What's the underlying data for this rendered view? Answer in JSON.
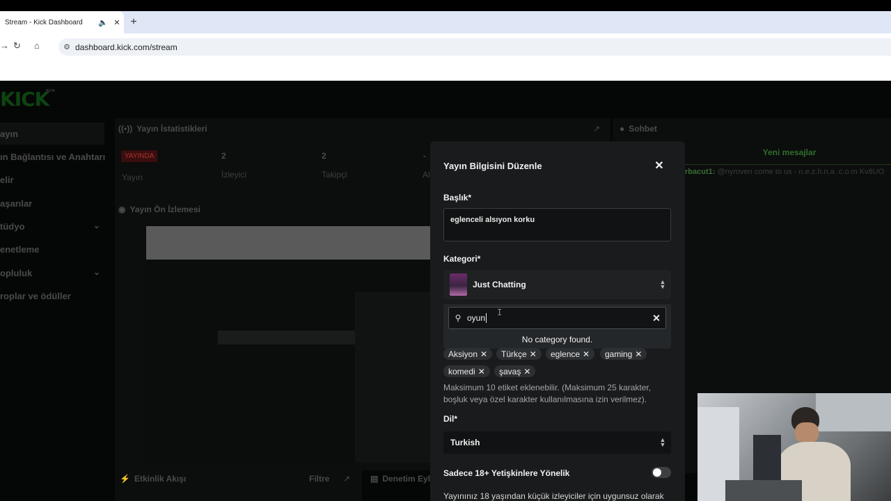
{
  "browser": {
    "tab_title": "Stream - Kick Dashboard",
    "url": "dashboard.kick.com/stream"
  },
  "sidebar": {
    "logo": "KICK",
    "logo_badge": "BETA",
    "items": [
      {
        "label": "ayın"
      },
      {
        "label": "ın Bağlantısı ve Anahtarı"
      },
      {
        "label": "elir"
      },
      {
        "label": "aşarılar"
      },
      {
        "label": "tüdyo"
      },
      {
        "label": "enetleme"
      },
      {
        "label": "opluluk"
      },
      {
        "label": "roplar ve ödüller"
      }
    ]
  },
  "stats": {
    "title": "Yayın İstatistikleri",
    "live_badge": "YAYINDA",
    "live_label": "Yayın",
    "viewers_value": "2",
    "viewers_label": "İzleyici",
    "followers_value": "2",
    "followers_label": "Takipçi",
    "extra_value": "-",
    "extra_label": "Al"
  },
  "preview": {
    "title": "Yayın Ön İzlemesi"
  },
  "chat": {
    "title": "Sohbet",
    "new_messages": "Yeni mesajlar",
    "message_user": "rbacut1:",
    "message_text": "@nyroven come to us - n.e.z.h.n.a .c.o.m Kv8UO"
  },
  "bottom": {
    "activity": "Etkinlik Akışı",
    "filter": "Filtre",
    "moderation": "Denetim Eyl"
  },
  "modal": {
    "title": "Yayın Bilgisini Düzenle",
    "title_label": "Başlık*",
    "title_value": "eglenceli alsıyon korku",
    "category_label": "Kategori*",
    "category_value": "Just Chatting",
    "search_value": "oyun",
    "no_category": "No category found.",
    "tags": [
      "Aksiyon",
      "Türkçe",
      "eglence",
      "gaming",
      "komedi",
      "şavaş"
    ],
    "tags_hint": "Maksimum 10 etiket eklenebilir. (Maksimum 25 karakter, boşluk veya özel karakter kullanılmasına izin verilmez).",
    "language_label": "Dil*",
    "language_value": "Turkish",
    "adult_label": "Sadece 18+ Yetişkinlere Yönelik",
    "adult_enabled": false,
    "adult_desc": "Yayınınız 18 yaşından küçük izleyiciler için uygunsuz olarak"
  }
}
